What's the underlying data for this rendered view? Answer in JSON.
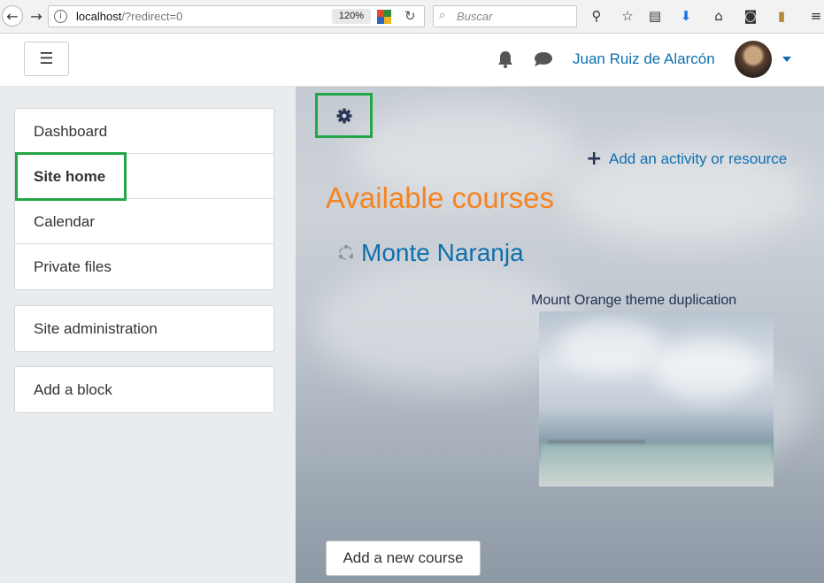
{
  "browser": {
    "url_host": "localhost",
    "url_path": "/?redirect=0",
    "zoom": "120%",
    "search_placeholder": "Buscar"
  },
  "header": {
    "menu_glyph": "☰",
    "user_name": "Juan Ruiz de Alarcón",
    "accent_color": "#0f6fae"
  },
  "nav": {
    "items": [
      {
        "label": "Dashboard"
      },
      {
        "label": "Site home",
        "active": true
      },
      {
        "label": "Calendar"
      },
      {
        "label": "Private files"
      }
    ],
    "site_admin": "Site administration",
    "add_block": "Add a block"
  },
  "main": {
    "add_activity": "Add an activity or resource",
    "courses_heading": "Available courses",
    "course": {
      "name": "Monte Naranja",
      "summary": "Mount Orange theme duplication"
    },
    "add_course": "Add a new course",
    "heading_color": "#f7831f",
    "highlight_color": "#22a646"
  }
}
